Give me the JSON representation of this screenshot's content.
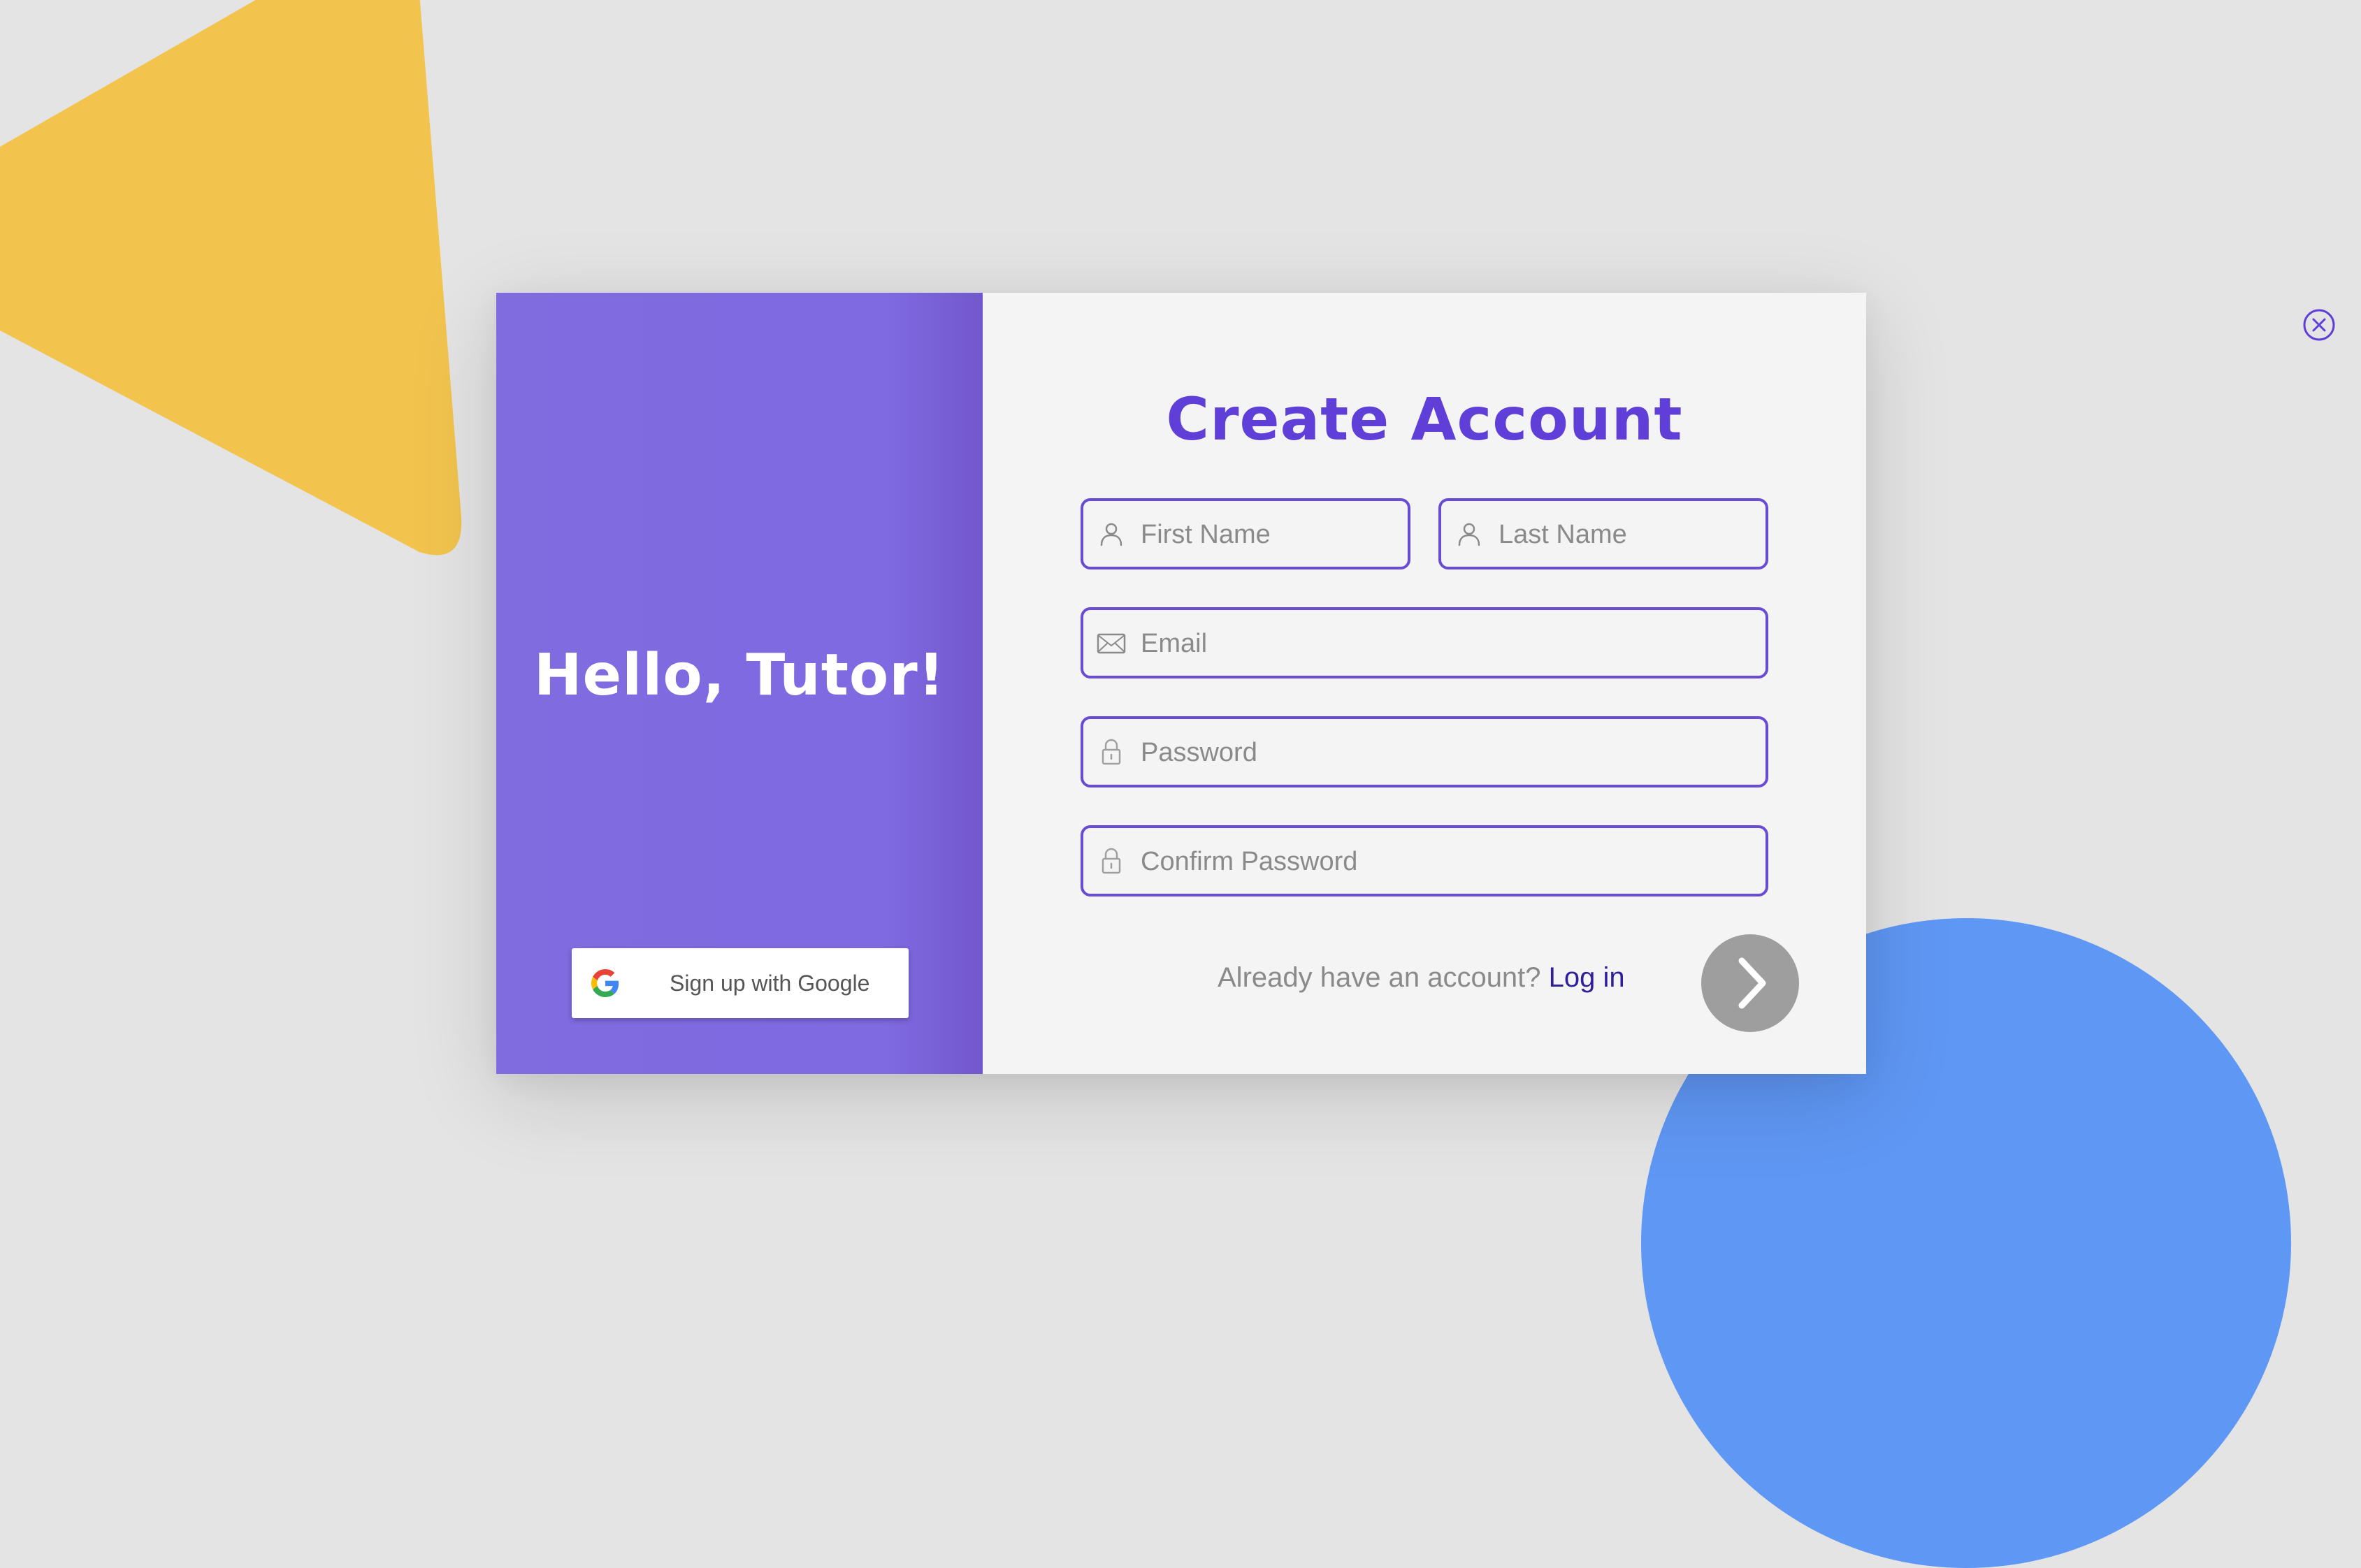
{
  "background": {
    "triangle_color": "#f2c44e",
    "circle_color": "#5f97f4",
    "page_color": "#e4e4e4"
  },
  "left_panel": {
    "greeting": "Hello, Tutor!",
    "google_button": {
      "label": "Sign up with Google",
      "icon": "google-logo-icon"
    },
    "color": "#806bdf"
  },
  "form": {
    "title": "Create Account",
    "close_icon": "close-circle-icon",
    "fields": {
      "first_name": {
        "placeholder": "First Name",
        "value": "",
        "icon": "user-icon"
      },
      "last_name": {
        "placeholder": "Last Name",
        "value": "",
        "icon": "user-icon"
      },
      "email": {
        "placeholder": "Email",
        "value": "",
        "icon": "envelope-icon"
      },
      "password": {
        "placeholder": "Password",
        "value": "",
        "icon": "lock-icon"
      },
      "confirm_password": {
        "placeholder": "Confirm Password",
        "value": "",
        "icon": "lock-icon"
      }
    },
    "footer": {
      "prompt": "Already have an account?",
      "login_link": "Log in"
    },
    "next_icon": "chevron-right-icon",
    "accent_color": "#5f3fd8",
    "field_border_color": "#6a4bd6"
  }
}
